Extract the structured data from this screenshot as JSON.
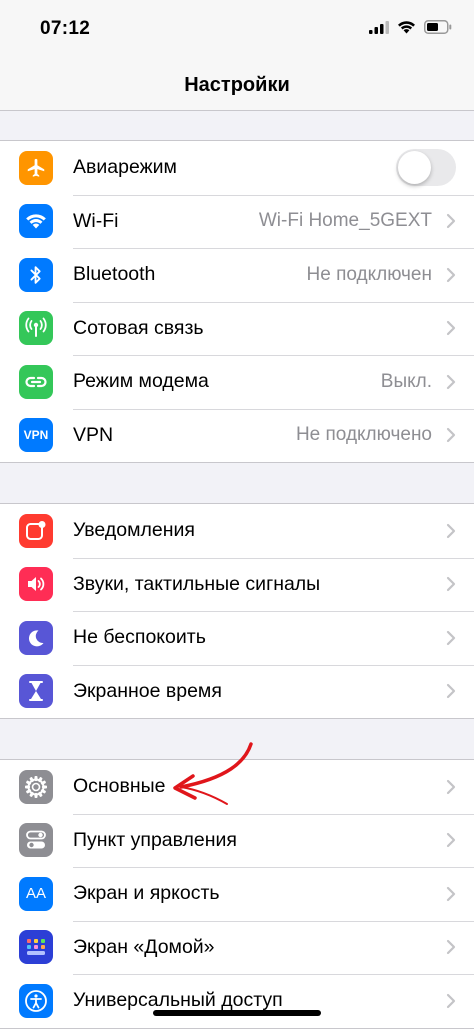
{
  "status_bar": {
    "time": "07:12"
  },
  "nav": {
    "title": "Настройки"
  },
  "colors": {
    "orange": "#ff9500",
    "blue": "#007aff",
    "green": "#34c759",
    "red": "#ff3b30",
    "pink": "#ff2d55",
    "purple": "#5856d6",
    "gray": "#8e8e93",
    "arrow_red": "#e0161b"
  },
  "groups": [
    {
      "rows": [
        {
          "label": "Авиарежим",
          "value": "",
          "icon": "airplane-icon",
          "control": "toggle"
        },
        {
          "label": "Wi-Fi",
          "value": "Wi-Fi Home_5GEXT",
          "icon": "wifi-icon"
        },
        {
          "label": "Bluetooth",
          "value": "Не подключен",
          "icon": "bluetooth-icon"
        },
        {
          "label": "Сотовая связь",
          "value": "",
          "icon": "cellular-icon"
        },
        {
          "label": "Режим модема",
          "value": "Выкл.",
          "icon": "hotspot-icon"
        },
        {
          "label": "VPN",
          "value": "Не подключено",
          "icon": "vpn-icon",
          "icon_text": "VPN"
        }
      ]
    },
    {
      "rows": [
        {
          "label": "Уведомления",
          "value": "",
          "icon": "notifications-icon"
        },
        {
          "label": "Звуки, тактильные сигналы",
          "value": "",
          "icon": "sounds-icon"
        },
        {
          "label": "Не беспокоить",
          "value": "",
          "icon": "moon-icon"
        },
        {
          "label": "Экранное время",
          "value": "",
          "icon": "hourglass-icon"
        }
      ]
    },
    {
      "rows": [
        {
          "label": "Основные",
          "value": "",
          "icon": "gear-icon"
        },
        {
          "label": "Пункт управления",
          "value": "",
          "icon": "control-center-icon"
        },
        {
          "label": "Экран и яркость",
          "value": "",
          "icon": "display-icon",
          "icon_text": "AA"
        },
        {
          "label": "Экран «Домой»",
          "value": "",
          "icon": "home-screen-icon"
        },
        {
          "label": "Универсальный доступ",
          "value": "",
          "icon": "accessibility-icon"
        }
      ]
    }
  ]
}
